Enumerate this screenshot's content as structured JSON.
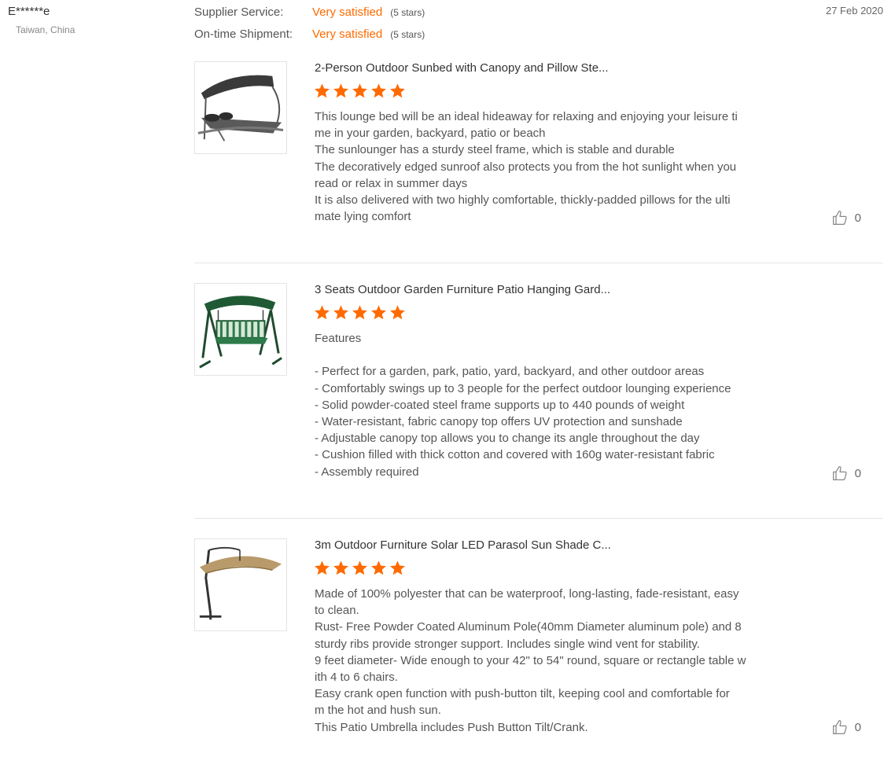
{
  "reviewer": {
    "name": "E******e",
    "location": "Taiwan, China",
    "date": "27 Feb 2020"
  },
  "ratings": [
    {
      "label": "Supplier Service:",
      "value": "Very satisfied",
      "stars": "(5 stars)"
    },
    {
      "label": "On-time Shipment:",
      "value": "Very satisfied",
      "stars": "(5 stars)"
    }
  ],
  "colors": {
    "accent": "#ff6a00",
    "text": "#555555",
    "divider": "#e6e6e6"
  },
  "items": [
    {
      "title": "2-Person Outdoor Sunbed with Canopy and Pillow Ste...",
      "rating": 5,
      "thumbnail_icon": "sunbed-image",
      "text": "This lounge bed will be an ideal hideaway for relaxing and enjoying your leisure ti\nme in your garden, backyard, patio or beach\nThe sunlounger has a sturdy steel frame, which is stable and durable\nThe decoratively edged sunroof also protects you from the hot sunlight when you\nread or relax in summer days\nIt is also delivered with two highly comfortable, thickly-padded pillows for the ulti\nmate lying comfort",
      "likes": "0"
    },
    {
      "title": "3 Seats Outdoor Garden Furniture Patio Hanging Gard...",
      "rating": 5,
      "thumbnail_icon": "swing-image",
      "text": "Features\n\n- Perfect for a garden, park, patio, yard, backyard, and other outdoor areas\n- Comfortably swings up to 3 people for the perfect outdoor lounging experience\n- Solid powder-coated steel frame supports up to 440 pounds of weight\n- Water-resistant, fabric canopy top offers UV protection and sunshade\n- Adjustable canopy top allows you to change its angle throughout the day\n- Cushion filled with thick cotton and covered with 160g water-resistant fabric\n- Assembly required",
      "likes": "0"
    },
    {
      "title": "3m Outdoor Furniture Solar LED Parasol Sun Shade C...",
      "rating": 5,
      "thumbnail_icon": "parasol-image",
      "text": "Made of 100% polyester that can be waterproof, long-lasting, fade-resistant, easy\nto clean.\nRust- Free Powder Coated Aluminum Pole(40mm Diameter aluminum pole) and 8\nsturdy ribs provide stronger support. Includes single wind vent for stability.\n9 feet diameter- Wide enough to your 42\" to 54\" round, square or rectangle table w\nith 4 to 6 chairs.\nEasy crank open function with push-button tilt, keeping cool and comfortable for\nm the hot and hush sun.\nThis Patio Umbrella includes Push Button Tilt/Crank.",
      "likes": "0"
    }
  ]
}
